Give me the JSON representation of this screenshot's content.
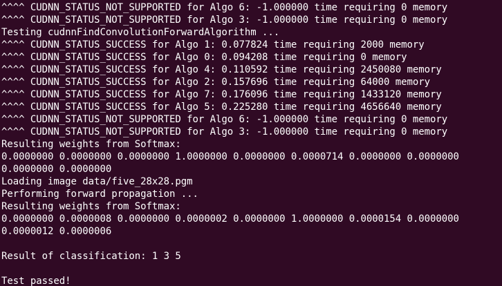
{
  "terminal": {
    "lines": [
      "^^^^ CUDNN_STATUS_NOT_SUPPORTED for Algo 6: -1.000000 time requiring 0 memory",
      "^^^^ CUDNN_STATUS_NOT_SUPPORTED for Algo 3: -1.000000 time requiring 0 memory",
      "Testing cudnnFindConvolutionForwardAlgorithm ...",
      "^^^^ CUDNN_STATUS_SUCCESS for Algo 1: 0.077824 time requiring 2000 memory",
      "^^^^ CUDNN_STATUS_SUCCESS for Algo 0: 0.094208 time requiring 0 memory",
      "^^^^ CUDNN_STATUS_SUCCESS for Algo 4: 0.110592 time requiring 2450080 memory",
      "^^^^ CUDNN_STATUS_SUCCESS for Algo 2: 0.157696 time requiring 64000 memory",
      "^^^^ CUDNN_STATUS_SUCCESS for Algo 7: 0.176096 time requiring 1433120 memory",
      "^^^^ CUDNN_STATUS_SUCCESS for Algo 5: 0.225280 time requiring 4656640 memory",
      "^^^^ CUDNN_STATUS_NOT_SUPPORTED for Algo 6: -1.000000 time requiring 0 memory",
      "^^^^ CUDNN_STATUS_NOT_SUPPORTED for Algo 3: -1.000000 time requiring 0 memory",
      "Resulting weights from Softmax:",
      "0.0000000 0.0000000 0.0000000 1.0000000 0.0000000 0.0000714 0.0000000 0.0000000",
      "0.0000000 0.0000000",
      "Loading image data/five_28x28.pgm",
      "Performing forward propagation ...",
      "Resulting weights from Softmax:",
      "0.0000000 0.0000008 0.0000000 0.0000002 0.0000000 1.0000000 0.0000154 0.0000000",
      "0.0000012 0.0000006",
      "",
      "Result of classification: 1 3 5",
      "",
      "Test passed!"
    ]
  },
  "colors": {
    "background": "#300a24",
    "foreground": "#ffffff"
  }
}
